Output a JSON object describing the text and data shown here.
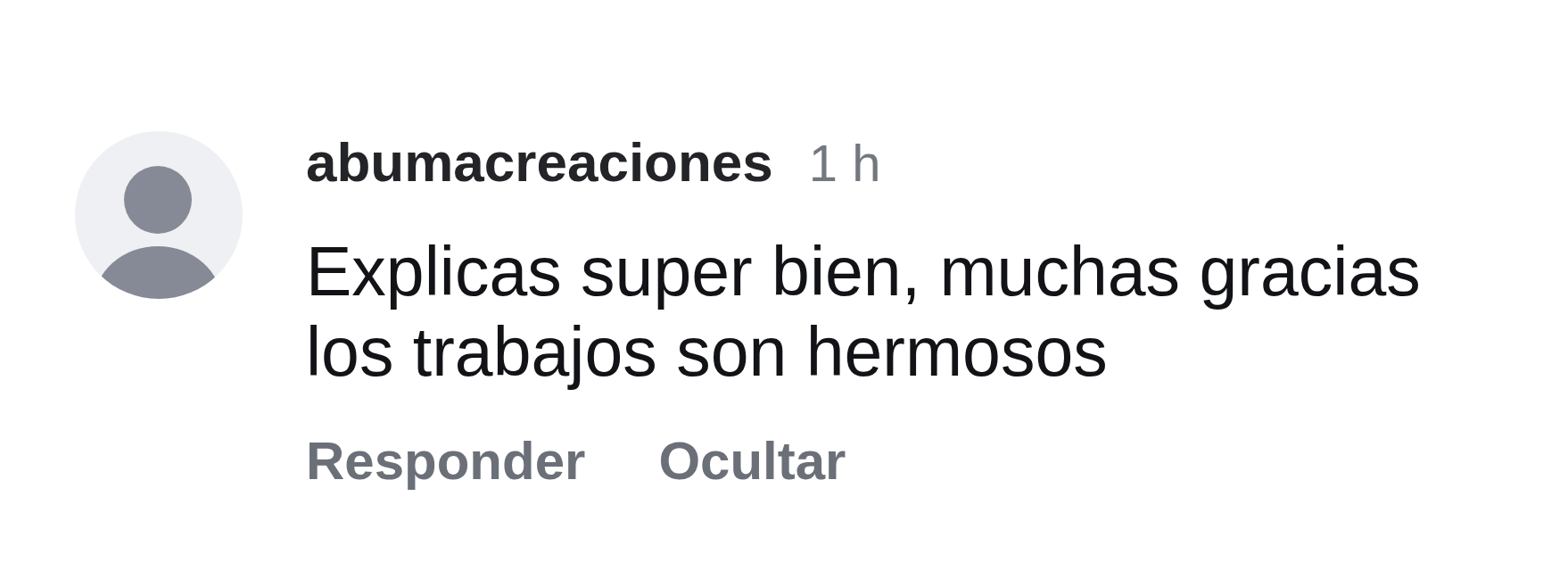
{
  "comment": {
    "author": "abumacreaciones",
    "time": "1 h",
    "text": "Explicas super bien, muchas gracias los trabajos son hermosos",
    "actions": [
      {
        "label": "Responder"
      },
      {
        "label": "Ocultar"
      }
    ]
  }
}
